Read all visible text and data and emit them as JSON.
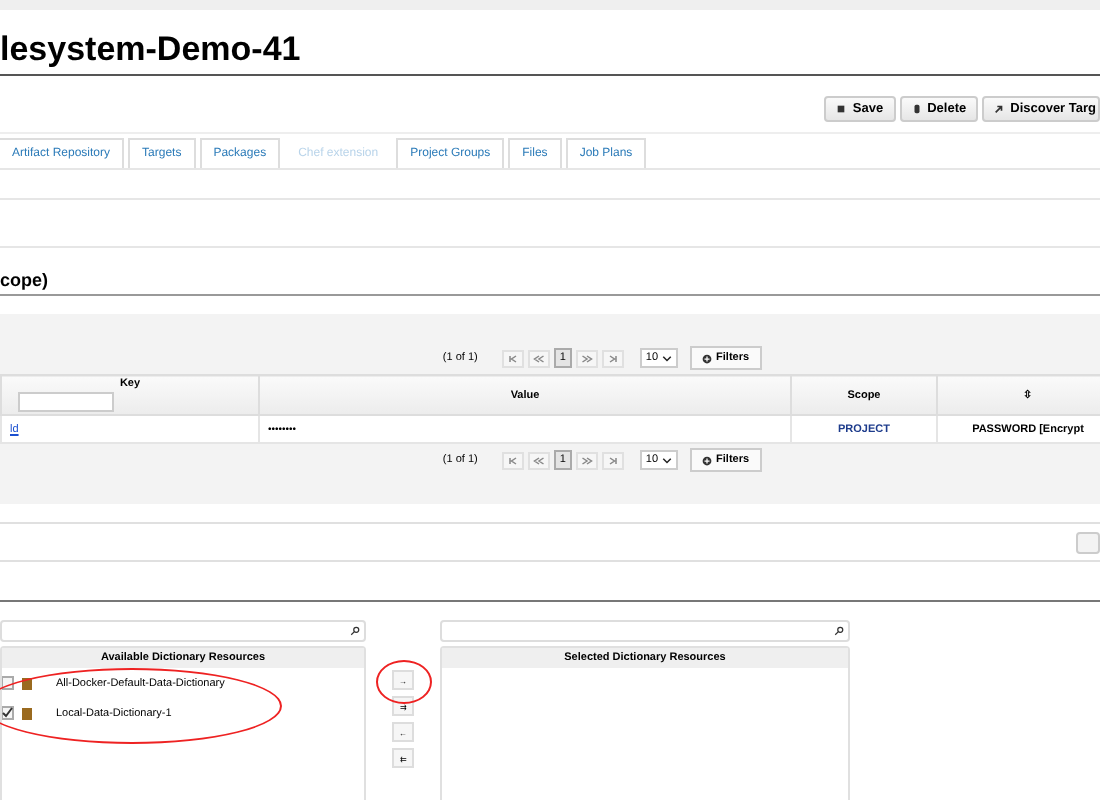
{
  "title": "lesystem-Demo-41",
  "actions": [
    "Save",
    "Delete",
    "Discover Targ"
  ],
  "tabs": [
    {
      "label": "Artifact Repository",
      "disabled": false
    },
    {
      "label": "Targets",
      "disabled": false
    },
    {
      "label": "Packages",
      "disabled": false
    },
    {
      "label": "Chef extension",
      "disabled": true
    },
    {
      "label": "Project Groups",
      "disabled": false
    },
    {
      "label": "Files",
      "disabled": false
    },
    {
      "label": "Job Plans",
      "disabled": false
    }
  ],
  "section_title": "cope)",
  "paginators": [
    {
      "report": "(1 of 1)",
      "page": "1",
      "rows": "10",
      "filters": "Filters"
    },
    {
      "report": "(1 of 1)",
      "page": "1",
      "rows": "10",
      "filters": "Filters"
    }
  ],
  "table": {
    "columns": [
      "Key",
      "Value",
      "Scope",
      "⇳"
    ],
    "rows": [
      {
        "key": "ld",
        "value": "••••••••",
        "scope": "PROJECT",
        "type": "PASSWORD [Encrypt"
      }
    ]
  },
  "picker": {
    "available_title": "Available Dictionary Resources",
    "selected_title": "Selected Dictionary Resources",
    "available": [
      {
        "label": "All-Docker-Default-Data-Dictionary",
        "checked": false
      },
      {
        "label": "Local-Data-Dictionary-1",
        "checked": true
      }
    ],
    "controls": [
      "→",
      "⇉",
      "←",
      "⇇"
    ]
  }
}
